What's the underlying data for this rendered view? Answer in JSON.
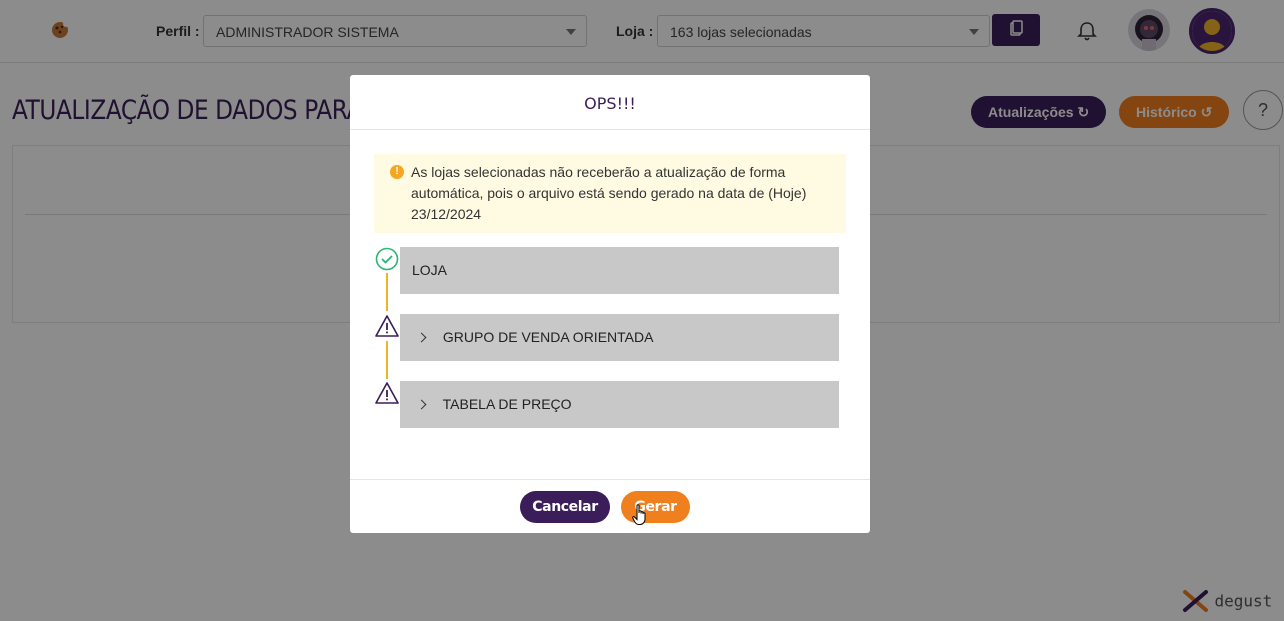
{
  "header": {
    "perfil_label": "Perfil :",
    "perfil_value": "ADMINISTRADOR SISTEMA",
    "loja_label": "Loja :",
    "loja_value": "163 lojas selecionadas"
  },
  "page": {
    "title": "ATUALIZAÇÃO DE DADOS PARA",
    "atualizacoes_label": "Atualizações",
    "historico_label": "Histórico",
    "help_label": "?",
    "brand": "degust"
  },
  "modal": {
    "title": "OPS!!!",
    "alert_text": "As lojas selecionadas não receberão a atualização de forma automática, pois o arquivo está sendo gerado na data de (Hoje) 23/12/2024",
    "steps": [
      {
        "label": "LOJA",
        "status": "success",
        "expandable": false
      },
      {
        "label": "GRUPO DE VENDA ORIENTADA",
        "status": "warning",
        "expandable": true
      },
      {
        "label": "TABELA DE PREÇO",
        "status": "warning",
        "expandable": true
      }
    ],
    "cancel_label": "Cancelar",
    "generate_label": "Gerar"
  },
  "colors": {
    "primary": "#3b1e59",
    "accent": "#f07f1e",
    "success": "#2bb673",
    "warning_line": "#f0b429"
  }
}
